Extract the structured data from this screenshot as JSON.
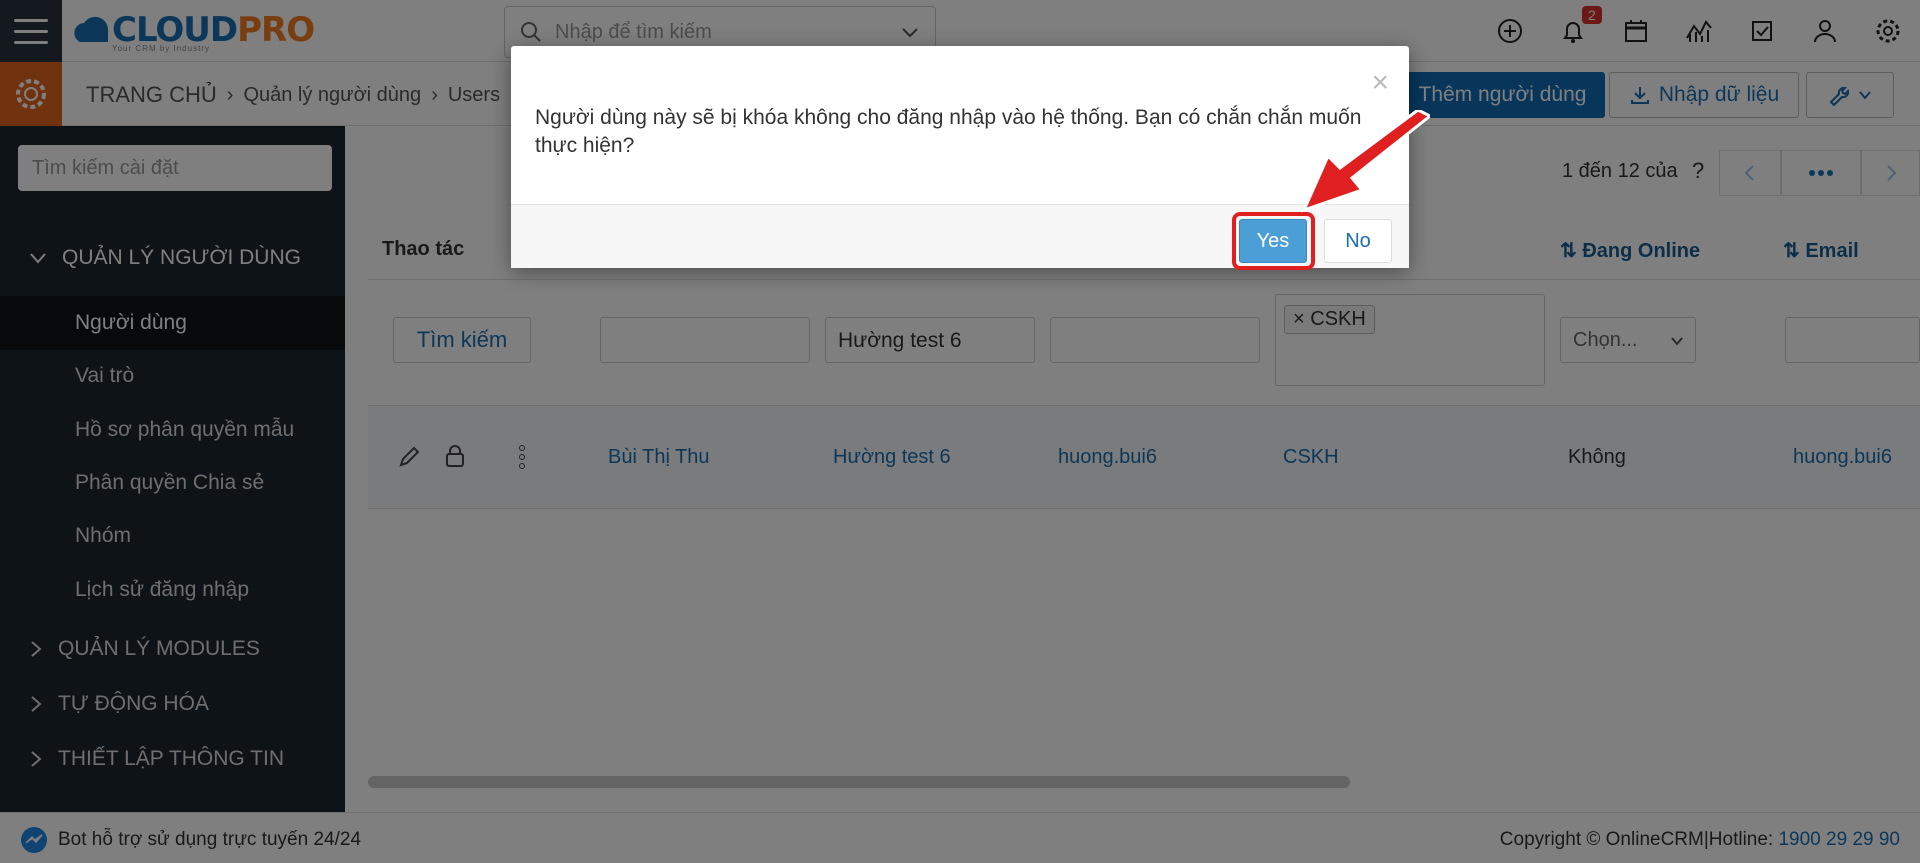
{
  "header": {
    "logo_main": "CLOUD",
    "logo_accent": "PRO",
    "logo_slogan": "Your CRM by Industry",
    "search_placeholder": "Nhập để tìm kiếm",
    "notification_count": "2",
    "icons": [
      "plus-circle-icon",
      "bell-icon",
      "calendar-icon",
      "chart-icon",
      "checkbox-icon",
      "user-icon",
      "settings-icon"
    ]
  },
  "breadcrumb": {
    "home": "TRANG CHỦ",
    "level1": "Quản lý người dùng",
    "level2": "Users"
  },
  "actions": {
    "add_user": "Thêm người dùng",
    "import": "Nhập dữ liệu"
  },
  "sidebar": {
    "search_placeholder": "Tìm kiếm cài đặt",
    "group_users": "QUẢN LÝ NGƯỜI DÙNG",
    "items": [
      {
        "label": "Người dùng",
        "active": true
      },
      {
        "label": "Vai trò"
      },
      {
        "label": "Hồ sơ phân quyền mẫu"
      },
      {
        "label": "Phân quyền Chia sẻ"
      },
      {
        "label": "Nhóm"
      },
      {
        "label": "Lịch sử đăng nhập"
      }
    ],
    "group_modules": "QUẢN LÝ MODULES",
    "group_automation": "TỰ ĐỘNG HÓA",
    "group_settings": "THIẾT LẬP THÔNG TIN"
  },
  "pager": {
    "range": "1 đến 12 của",
    "help": "?"
  },
  "table": {
    "headers": {
      "actions": "Thao tác",
      "online": "Đang Online",
      "email": "Email"
    },
    "filters": {
      "search_button": "Tìm kiếm",
      "last_name": "Hường test 6",
      "role_tag": "CSKH",
      "online_select": "Chọn..."
    },
    "row": {
      "first_name": "Bùi Thị Thu",
      "last_name": "Hường test 6",
      "username": "huong.bui6",
      "role": "CSKH",
      "online": "Không",
      "email": "huong.bui6"
    }
  },
  "footer": {
    "bot_text": "Bot hỗ trợ sử dụng trực tuyến 24/24",
    "copyright": "Copyright © OnlineCRM|Hotline: ",
    "hotline": "1900 29 29 90"
  },
  "modal": {
    "message": "Người dùng này sẽ bị khóa không cho đăng nhập vào hệ thống. Bạn có chắn chắn muốn thực hiện?",
    "yes": "Yes",
    "no": "No",
    "close": "×"
  },
  "colors": {
    "primary": "#106db6",
    "accent": "#e0641e",
    "sidebar": "#1d2630",
    "highlight": "#e02020"
  }
}
